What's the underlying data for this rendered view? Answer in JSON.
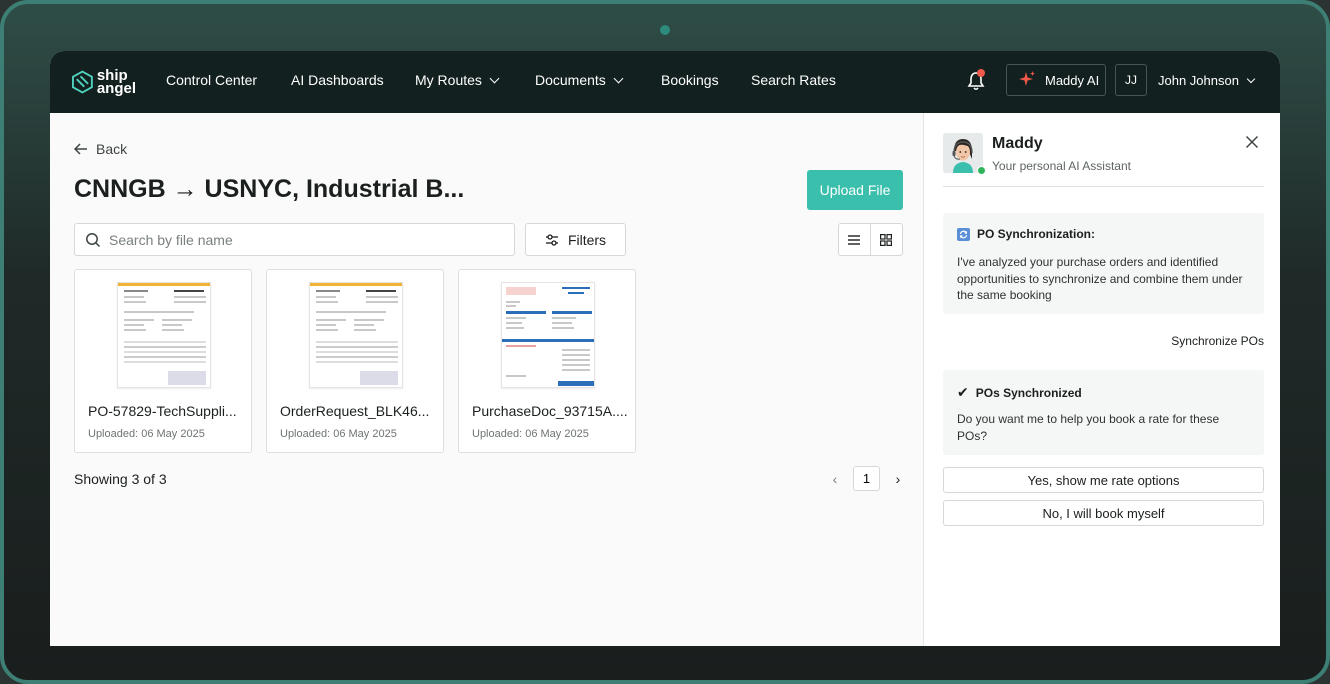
{
  "nav": {
    "logo_line1": "ship",
    "logo_line2": "angel",
    "items": [
      {
        "label": "Control Center"
      },
      {
        "label": "AI Dashboards"
      },
      {
        "label": "My Routes"
      },
      {
        "label": "Documents"
      },
      {
        "label": "Bookings"
      },
      {
        "label": "Search Rates"
      }
    ],
    "ai_button": "Maddy AI",
    "user_initials": "JJ",
    "user_name": "John Johnson"
  },
  "main": {
    "back_label": "Back",
    "title": "CNNGB → USNYC, Industrial B...",
    "upload_label": "Upload File",
    "search_placeholder": "Search by file name",
    "filters_label": "Filters",
    "files": [
      {
        "name": "PO-57829-TechSuppli...",
        "date": "Uploaded: 06 May 2025"
      },
      {
        "name": "OrderRequest_BLK46...",
        "date": "Uploaded: 06 May 2025"
      },
      {
        "name": "PurchaseDoc_93715A....",
        "date": "Uploaded: 06 May 2025"
      }
    ],
    "showing": "Showing 3 of 3",
    "page": "1"
  },
  "panel": {
    "name": "Maddy",
    "subtitle": "Your personal AI Assistant",
    "msg1_title": "PO Synchronization:",
    "msg1_body": "I've analyzed your purchase orders and identified opportunities to synchronize and combine them under the same booking",
    "sync_action": "Synchronize POs",
    "msg2_title": "POs Synchronized",
    "msg2_body": "Do you want me to help you book a rate for these POs?",
    "btn_yes": "Yes, show me rate options",
    "btn_no": "No, I will book myself"
  },
  "colors": {
    "accent": "#3bbfad",
    "nav_bg": "#12201f",
    "notification": "#f05a4a",
    "online": "#2fb35b"
  }
}
